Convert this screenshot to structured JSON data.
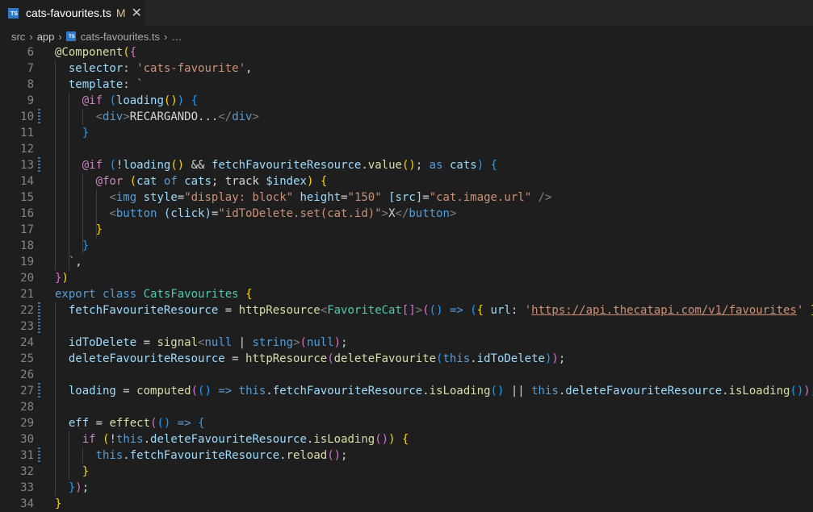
{
  "tab": {
    "filename": "cats-favourites.ts",
    "modified": "M",
    "close_glyph": "✕",
    "icon": "typescript-file-icon"
  },
  "breadcrumbs": [
    "src",
    "app",
    "cats-favourites.ts",
    "…"
  ],
  "lines": [
    {
      "num": "6",
      "tokens": [
        [
          "d",
          "@Component"
        ],
        [
          "b1",
          "("
        ],
        [
          "b2",
          "{"
        ]
      ]
    },
    {
      "num": "7",
      "tokens": [
        [
          "p",
          "  "
        ],
        [
          "var",
          "selector"
        ],
        [
          "p",
          ": "
        ],
        [
          "str",
          "'cats-favourite'"
        ],
        [
          "p",
          ","
        ]
      ]
    },
    {
      "num": "8",
      "tokens": [
        [
          "p",
          "  "
        ],
        [
          "var",
          "template"
        ],
        [
          "p",
          ": "
        ],
        [
          "str",
          "`"
        ]
      ]
    },
    {
      "num": "9",
      "tokens": [
        [
          "p",
          "    "
        ],
        [
          "ctl",
          "@if"
        ],
        [
          "p",
          " "
        ],
        [
          "b3",
          "("
        ],
        [
          "var",
          "loading"
        ],
        [
          "b1",
          "()"
        ],
        [
          "b3",
          ")"
        ],
        [
          "p",
          " "
        ],
        [
          "b3",
          "{"
        ]
      ]
    },
    {
      "num": "10",
      "tokens": [
        [
          "p",
          "      "
        ],
        [
          "ang",
          "<"
        ],
        [
          "tag",
          "div"
        ],
        [
          "ang",
          ">"
        ],
        [
          "p",
          "RECARGANDO..."
        ],
        [
          "ang",
          "</"
        ],
        [
          "tag",
          "div"
        ],
        [
          "ang",
          ">"
        ]
      ]
    },
    {
      "num": "11",
      "tokens": [
        [
          "p",
          "    "
        ],
        [
          "b3",
          "}"
        ]
      ]
    },
    {
      "num": "12",
      "tokens": []
    },
    {
      "num": "13",
      "tokens": [
        [
          "p",
          "    "
        ],
        [
          "ctl",
          "@if"
        ],
        [
          "p",
          " "
        ],
        [
          "b3",
          "("
        ],
        [
          "p",
          "!"
        ],
        [
          "var",
          "loading"
        ],
        [
          "b1",
          "()"
        ],
        [
          "p",
          " && "
        ],
        [
          "var",
          "fetchFavouriteResource"
        ],
        [
          "p",
          "."
        ],
        [
          "fn",
          "value"
        ],
        [
          "b1",
          "()"
        ],
        [
          "p",
          "; "
        ],
        [
          "k",
          "as"
        ],
        [
          "p",
          " "
        ],
        [
          "var",
          "cats"
        ],
        [
          "b3",
          ")"
        ],
        [
          "p",
          " "
        ],
        [
          "b3",
          "{"
        ]
      ]
    },
    {
      "num": "14",
      "tokens": [
        [
          "p",
          "      "
        ],
        [
          "ctl",
          "@for"
        ],
        [
          "p",
          " "
        ],
        [
          "b1",
          "("
        ],
        [
          "var",
          "cat"
        ],
        [
          "p",
          " "
        ],
        [
          "k",
          "of"
        ],
        [
          "p",
          " "
        ],
        [
          "var",
          "cats"
        ],
        [
          "p",
          "; track "
        ],
        [
          "var",
          "$index"
        ],
        [
          "b1",
          ")"
        ],
        [
          "p",
          " "
        ],
        [
          "b1",
          "{"
        ]
      ]
    },
    {
      "num": "15",
      "tokens": [
        [
          "p",
          "        "
        ],
        [
          "ang",
          "<"
        ],
        [
          "tag",
          "img"
        ],
        [
          "p",
          " "
        ],
        [
          "var",
          "style"
        ],
        [
          "p",
          "="
        ],
        [
          "str",
          "\"display: block\""
        ],
        [
          "p",
          " "
        ],
        [
          "var",
          "height"
        ],
        [
          "p",
          "="
        ],
        [
          "str",
          "\"150\""
        ],
        [
          "p",
          " "
        ],
        [
          "var",
          "[src]"
        ],
        [
          "p",
          "="
        ],
        [
          "str",
          "\"cat.image.url\""
        ],
        [
          "p",
          " "
        ],
        [
          "ang",
          "/>"
        ]
      ]
    },
    {
      "num": "16",
      "tokens": [
        [
          "p",
          "        "
        ],
        [
          "ang",
          "<"
        ],
        [
          "tag",
          "button"
        ],
        [
          "p",
          " "
        ],
        [
          "var",
          "(click)"
        ],
        [
          "p",
          "="
        ],
        [
          "str",
          "\"idToDelete.set(cat.id)\""
        ],
        [
          "ang",
          ">"
        ],
        [
          "p",
          "X"
        ],
        [
          "ang",
          "</"
        ],
        [
          "tag",
          "button"
        ],
        [
          "ang",
          ">"
        ]
      ]
    },
    {
      "num": "17",
      "tokens": [
        [
          "p",
          "      "
        ],
        [
          "b1",
          "}"
        ]
      ]
    },
    {
      "num": "18",
      "tokens": [
        [
          "p",
          "    "
        ],
        [
          "b3",
          "}"
        ]
      ]
    },
    {
      "num": "19",
      "tokens": [
        [
          "p",
          "  "
        ],
        [
          "str",
          "`"
        ],
        [
          "p",
          ","
        ]
      ]
    },
    {
      "num": "20",
      "tokens": [
        [
          "b2",
          "}"
        ],
        [
          "b1",
          ")"
        ]
      ]
    },
    {
      "num": "21",
      "tokens": [
        [
          "k",
          "export"
        ],
        [
          "p",
          " "
        ],
        [
          "k",
          "class"
        ],
        [
          "p",
          " "
        ],
        [
          "ty",
          "CatsFavourites"
        ],
        [
          "p",
          " "
        ],
        [
          "b1",
          "{"
        ]
      ]
    },
    {
      "num": "22",
      "tokens": [
        [
          "p",
          "  "
        ],
        [
          "var",
          "fetchFavouriteResource"
        ],
        [
          "p",
          " = "
        ],
        [
          "fn",
          "httpResource"
        ],
        [
          "ang",
          "<"
        ],
        [
          "ty",
          "FavoriteCat"
        ],
        [
          "b2",
          "[]"
        ],
        [
          "ang",
          ">"
        ],
        [
          "b2",
          "("
        ],
        [
          "b3",
          "()"
        ],
        [
          "p",
          " "
        ],
        [
          "k",
          "=>"
        ],
        [
          "p",
          " "
        ],
        [
          "b3",
          "("
        ],
        [
          "b1",
          "{"
        ],
        [
          "p",
          " "
        ],
        [
          "var",
          "url"
        ],
        [
          "p",
          ": "
        ],
        [
          "str",
          "'"
        ],
        [
          "url",
          "https://api.thecatapi.com/v1/favourites"
        ],
        [
          "str",
          "'"
        ],
        [
          "p",
          " "
        ],
        [
          "b1",
          "}"
        ],
        [
          "b3",
          ")"
        ],
        [
          "b2",
          ")"
        ],
        [
          "p",
          ";"
        ]
      ]
    },
    {
      "num": "23",
      "tokens": []
    },
    {
      "num": "24",
      "tokens": [
        [
          "p",
          "  "
        ],
        [
          "var",
          "idToDelete"
        ],
        [
          "p",
          " = "
        ],
        [
          "fn",
          "signal"
        ],
        [
          "ang",
          "<"
        ],
        [
          "k",
          "null"
        ],
        [
          "p",
          " | "
        ],
        [
          "k",
          "string"
        ],
        [
          "ang",
          ">"
        ],
        [
          "b2",
          "("
        ],
        [
          "k",
          "null"
        ],
        [
          "b2",
          ")"
        ],
        [
          "p",
          ";"
        ]
      ]
    },
    {
      "num": "25",
      "tokens": [
        [
          "p",
          "  "
        ],
        [
          "var",
          "deleteFavouriteResource"
        ],
        [
          "p",
          " = "
        ],
        [
          "fn",
          "httpResource"
        ],
        [
          "b2",
          "("
        ],
        [
          "fn",
          "deleteFavourite"
        ],
        [
          "b3",
          "("
        ],
        [
          "k",
          "this"
        ],
        [
          "p",
          "."
        ],
        [
          "var",
          "idToDelete"
        ],
        [
          "b3",
          ")"
        ],
        [
          "b2",
          ")"
        ],
        [
          "p",
          ";"
        ]
      ]
    },
    {
      "num": "26",
      "tokens": []
    },
    {
      "num": "27",
      "tokens": [
        [
          "p",
          "  "
        ],
        [
          "var",
          "loading"
        ],
        [
          "p",
          " = "
        ],
        [
          "fn",
          "computed"
        ],
        [
          "b2",
          "("
        ],
        [
          "b3",
          "()"
        ],
        [
          "p",
          " "
        ],
        [
          "k",
          "=>"
        ],
        [
          "p",
          " "
        ],
        [
          "k",
          "this"
        ],
        [
          "p",
          "."
        ],
        [
          "var",
          "fetchFavouriteResource"
        ],
        [
          "p",
          "."
        ],
        [
          "fn",
          "isLoading"
        ],
        [
          "b3",
          "()"
        ],
        [
          "p",
          " || "
        ],
        [
          "k",
          "this"
        ],
        [
          "p",
          "."
        ],
        [
          "var",
          "deleteFavouriteResource"
        ],
        [
          "p",
          "."
        ],
        [
          "fn",
          "isLoading"
        ],
        [
          "b3",
          "()"
        ],
        [
          "b2",
          ")"
        ],
        [
          "p",
          ";"
        ]
      ]
    },
    {
      "num": "28",
      "tokens": []
    },
    {
      "num": "29",
      "tokens": [
        [
          "p",
          "  "
        ],
        [
          "var",
          "eff"
        ],
        [
          "p",
          " = "
        ],
        [
          "fn",
          "effect"
        ],
        [
          "b2",
          "("
        ],
        [
          "b3",
          "()"
        ],
        [
          "p",
          " "
        ],
        [
          "k",
          "=>"
        ],
        [
          "p",
          " "
        ],
        [
          "b3",
          "{"
        ]
      ]
    },
    {
      "num": "30",
      "tokens": [
        [
          "p",
          "    "
        ],
        [
          "ctl",
          "if"
        ],
        [
          "p",
          " "
        ],
        [
          "b1",
          "("
        ],
        [
          "p",
          "!"
        ],
        [
          "k",
          "this"
        ],
        [
          "p",
          "."
        ],
        [
          "var",
          "deleteFavouriteResource"
        ],
        [
          "p",
          "."
        ],
        [
          "fn",
          "isLoading"
        ],
        [
          "b2",
          "()"
        ],
        [
          "b1",
          ")"
        ],
        [
          "p",
          " "
        ],
        [
          "b1",
          "{"
        ]
      ]
    },
    {
      "num": "31",
      "tokens": [
        [
          "p",
          "      "
        ],
        [
          "k",
          "this"
        ],
        [
          "p",
          "."
        ],
        [
          "var",
          "fetchFavouriteResource"
        ],
        [
          "p",
          "."
        ],
        [
          "fn",
          "reload"
        ],
        [
          "b2",
          "()"
        ],
        [
          "p",
          ";"
        ]
      ]
    },
    {
      "num": "32",
      "tokens": [
        [
          "p",
          "    "
        ],
        [
          "b1",
          "}"
        ]
      ]
    },
    {
      "num": "33",
      "tokens": [
        [
          "p",
          "  "
        ],
        [
          "b3",
          "}"
        ],
        [
          "b2",
          ")"
        ],
        [
          "p",
          ";"
        ]
      ]
    },
    {
      "num": "34",
      "tokens": [
        [
          "b1",
          "}"
        ]
      ]
    }
  ],
  "modified_lines": [
    "10",
    "13",
    "22",
    "23",
    "27",
    "31"
  ],
  "colors": {
    "background": "#1e1e1e",
    "keyword": "#569cd6",
    "control": "#c586c0",
    "function": "#dcdcaa",
    "string": "#ce9178",
    "variable": "#9cdcfe",
    "type": "#4ec9b0",
    "bracket1": "#ffd700",
    "bracket2": "#da70d6",
    "bracket3": "#179fff",
    "gutter_modified": "#2d77c7"
  }
}
